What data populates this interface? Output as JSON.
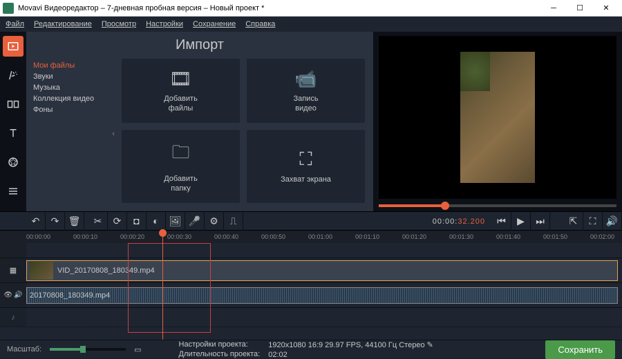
{
  "window": {
    "title": "Movavi Видеоредактор – 7-дневная пробная версия – Новый проект *"
  },
  "menu": {
    "file": "Файл",
    "edit": "Редактирование",
    "view": "Просмотр",
    "settings": "Настройки",
    "save": "Сохранение",
    "help": "Справка"
  },
  "import": {
    "title": "Импорт",
    "cats": {
      "myfiles": "Мои файлы",
      "sounds": "Звуки",
      "music": "Музыка",
      "videocol": "Коллекция видео",
      "backs": "Фоны"
    },
    "btns": {
      "addfiles": "Добавить\nфайлы",
      "recvideo": "Запись\nвидео",
      "addfolder": "Добавить\nпапку",
      "screencap": "Захват экрана"
    }
  },
  "timecode": {
    "white": "00:00:",
    "orange": "32.200"
  },
  "ruler": [
    "00:00:00",
    "00:00:10",
    "00:00:20",
    "00:00:30",
    "00:00:40",
    "00:00:50",
    "00:01:00",
    "00:01:10",
    "00:01:20",
    "00:01:30",
    "00:01:40",
    "00:01:50",
    "00:02:00"
  ],
  "clips": {
    "video": "VID_20170808_180349.mp4",
    "audio": "20170808_180349.mp4"
  },
  "status": {
    "zoom": "Масштаб:",
    "proj_label": "Настройки проекта:",
    "proj_value": "1920x1080 16:9 29.97 FPS, 44100 Гц Стерео",
    "dur_label": "Длительность проекта:",
    "dur_value": "02:02",
    "save": "Сохранить"
  }
}
